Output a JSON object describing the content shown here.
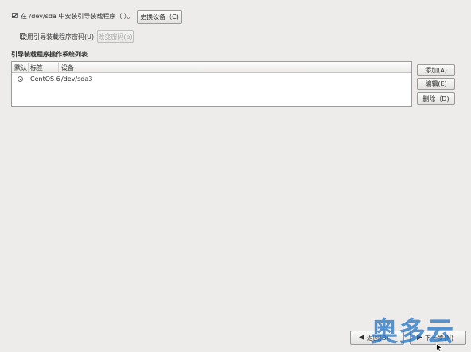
{
  "install_loader": {
    "checked": true,
    "label": "在 /dev/sda 中安装引导装载程序（I）。",
    "change_device_button": "更换设备（C)"
  },
  "loader_password": {
    "checked": false,
    "label": "使用引导装载程序密码(U)",
    "change_password_button": "改变密码(p)"
  },
  "os_list": {
    "title": "引导装载程序操作系统列表",
    "columns": [
      "默认",
      "标签",
      "设备"
    ],
    "rows": [
      {
        "default": true,
        "label": "CentOS 6",
        "device": "/dev/sda3"
      }
    ],
    "add_button": "添加(A)",
    "edit_button": "编辑(E)",
    "delete_button": "删除（D)"
  },
  "nav": {
    "back_button": "返回(B)",
    "next_button": "下一步(N)"
  },
  "watermark": "奥多云"
}
